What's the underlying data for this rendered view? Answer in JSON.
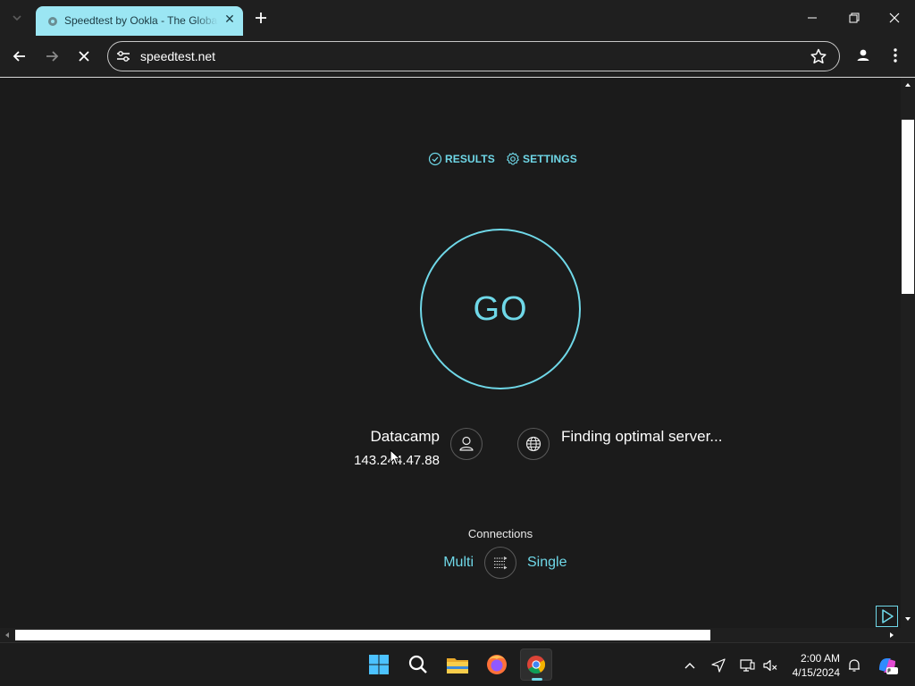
{
  "browser": {
    "tab": {
      "title": "Speedtest by Ookla - The Global Broadband Speed Test",
      "close_glyph": "✕"
    },
    "new_tab_glyph": "+",
    "url": "speedtest.net",
    "icons": {
      "tab_list": "chevron-down-icon",
      "favicon": "speedtest-favicon",
      "back": "back-arrow-icon",
      "forward": "forward-arrow-icon",
      "stop": "stop-loading-icon",
      "site_info": "tune-icon",
      "bookmark": "star-icon",
      "profile": "person-icon",
      "menu": "kebab-menu-icon",
      "minimize": "minimize-icon",
      "restore": "restore-icon",
      "close": "close-icon"
    }
  },
  "speedtest": {
    "nav": {
      "results_label": "RESULTS",
      "settings_label": "SETTINGS"
    },
    "go_label": "GO",
    "isp": {
      "name": "Datacamp",
      "ip": "143.244.47.88"
    },
    "server_status": "Finding optimal server...",
    "connections": {
      "label": "Connections",
      "multi": "Multi",
      "single": "Single",
      "selected": "Multi"
    }
  },
  "taskbar": {
    "apps": [
      "windows-start-icon",
      "search-icon",
      "file-explorer-icon",
      "firefox-icon",
      "chrome-icon"
    ],
    "active_app": "chrome-icon",
    "tray": [
      "chevron-up-icon",
      "location-icon",
      "network-icon",
      "volume-muted-icon",
      "notification-bell-icon",
      "copilot-icon"
    ],
    "clock": {
      "time": "2:00 AM",
      "date": "4/15/2024"
    }
  },
  "colors": {
    "accent": "#6fd8e8",
    "tab_active": "#9be6f3",
    "page_bg": "#1b1b1b",
    "chrome_bg": "#1f1f1f"
  }
}
